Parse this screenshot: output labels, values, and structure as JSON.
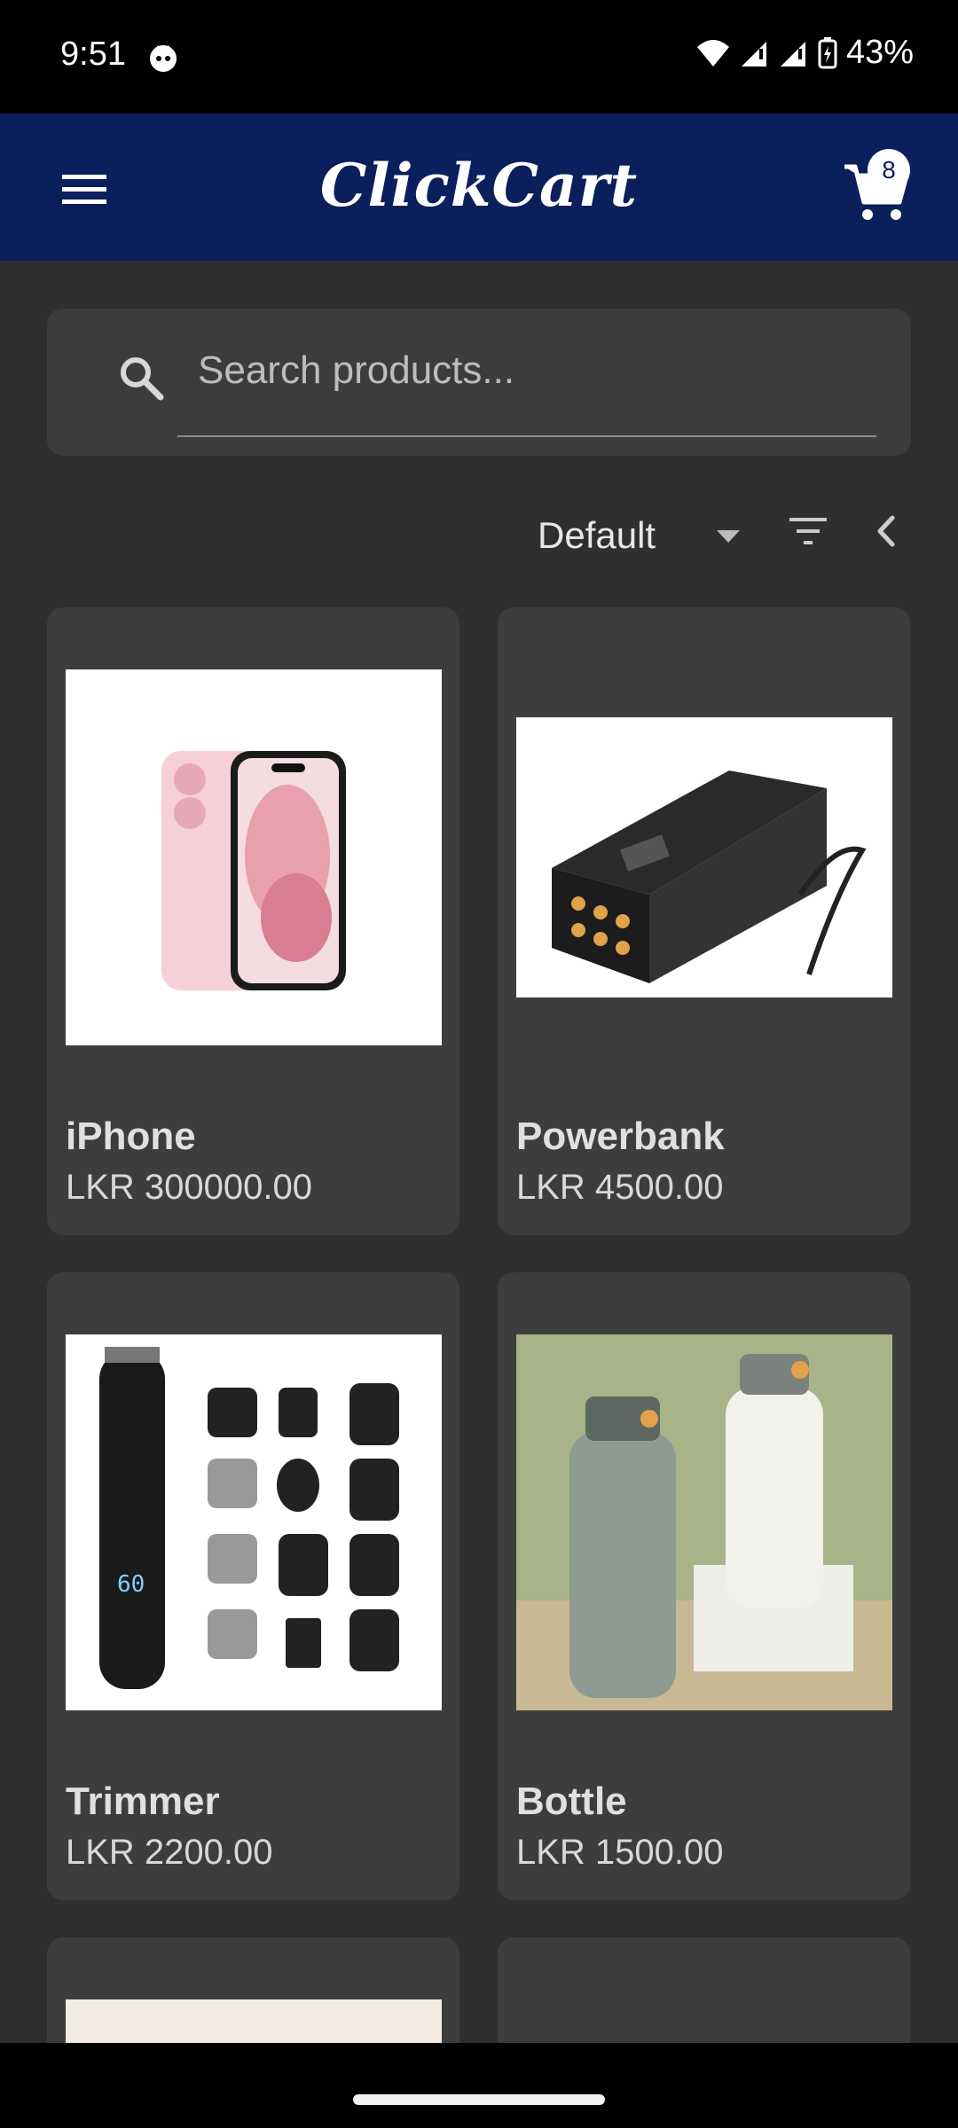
{
  "status_bar": {
    "time": "9:51",
    "battery_percent": "43%"
  },
  "app_bar": {
    "title": "ClickCart",
    "cart_count": "8"
  },
  "search": {
    "placeholder": "Search products..."
  },
  "sort": {
    "selected": "Default"
  },
  "products": [
    {
      "name": "iPhone",
      "price": "LKR 300000.00"
    },
    {
      "name": "Powerbank",
      "price": "LKR 4500.00"
    },
    {
      "name": "Trimmer",
      "price": "LKR 2200.00"
    },
    {
      "name": "Bottle",
      "price": "LKR 1500.00"
    }
  ],
  "colors": {
    "app_bar": "#0a1f5c",
    "background": "#2f2f2f",
    "card": "#3d3d3d"
  }
}
